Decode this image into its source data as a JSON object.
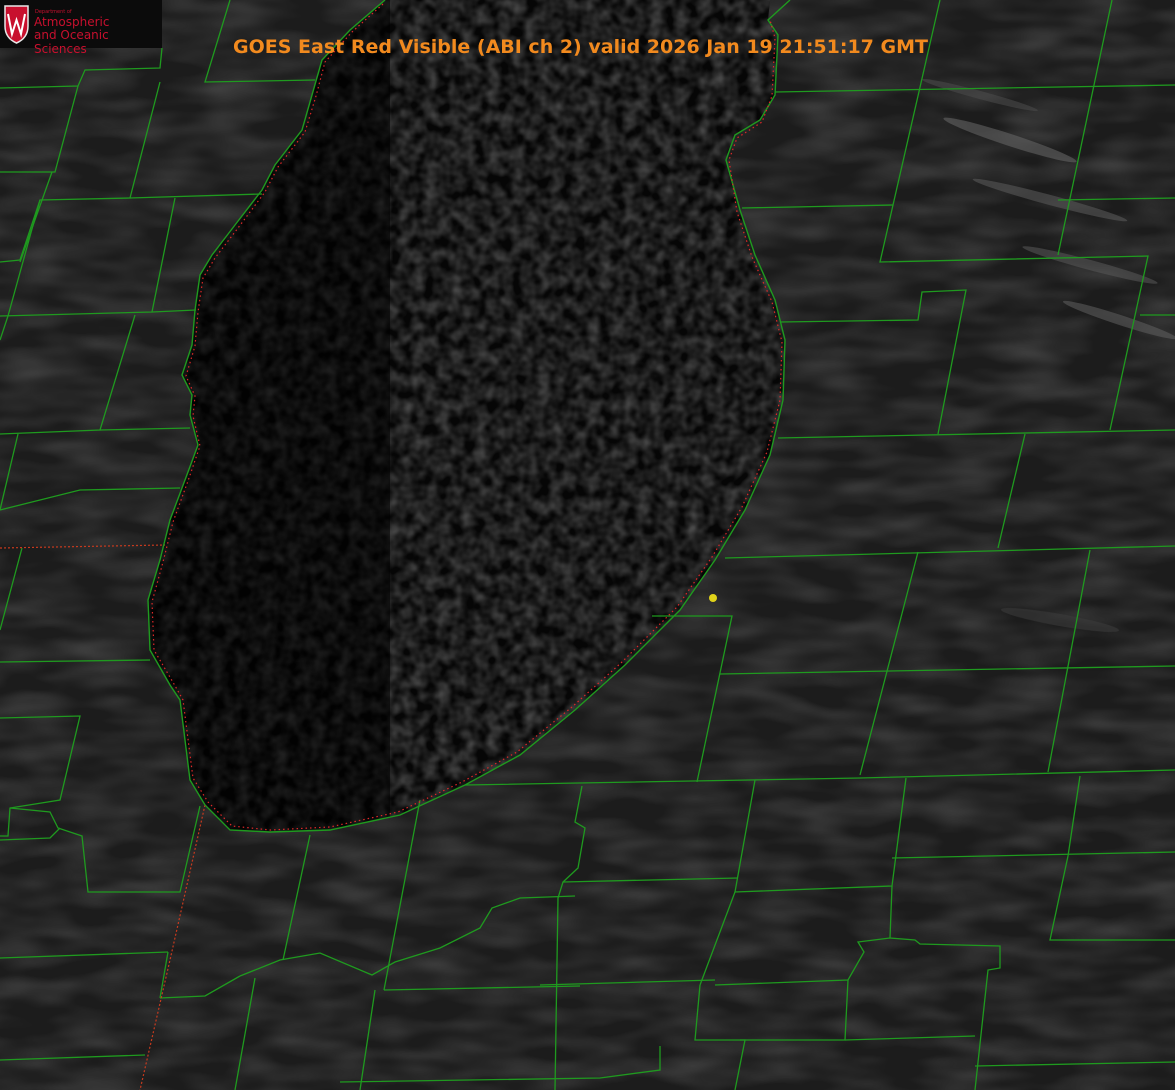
{
  "title": "GOES East Red Visible (ABI ch 2) valid 2026 Jan 19 21:51:17 GMT",
  "logo": {
    "dept": "Department of",
    "line1": "Atmospheric",
    "line2": "and Oceanic Sciences",
    "shield_letter": "W"
  },
  "colors": {
    "title": "#f28a1e",
    "county_lines": "#1f9a1f",
    "state_lines": "#c83a1e",
    "shoreline_dotted": "#e02828",
    "marker": "#e0d21a",
    "logo_text": "#c8102e"
  },
  "layers": {
    "counties": "county-boundaries",
    "states": "state-boundaries",
    "lake": "lake-michigan-shoreline",
    "marker": "location-marker"
  }
}
